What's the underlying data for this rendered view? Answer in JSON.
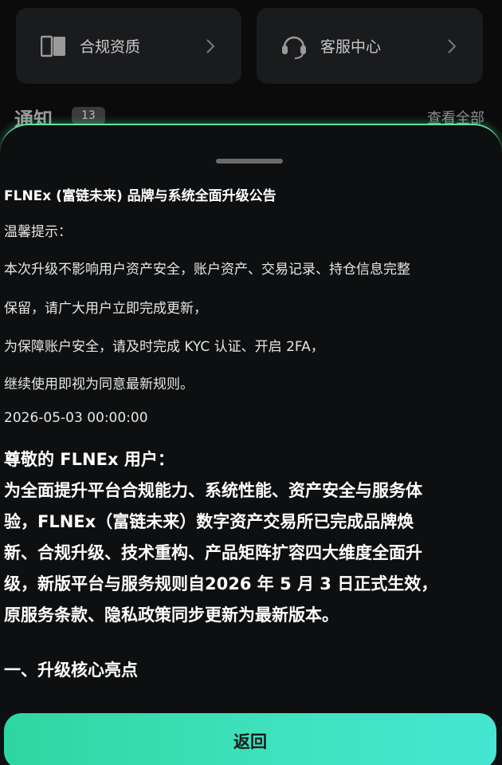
{
  "cards": {
    "compliance": {
      "label": "合规资质",
      "icon": "book-icon"
    },
    "service": {
      "label": "客服中心",
      "icon": "headset-icon"
    }
  },
  "notice": {
    "title": "通知",
    "count": "13",
    "view_all": "查看全部"
  },
  "announcement": {
    "title": "FLNEx (富链未来) 品牌与系统全面升级公告",
    "tip_header": "温馨提示：",
    "tip_lines": [
      "本次升级不影响用户资产安全，账户资产、交易记录、持仓信息完整",
      "保留，请广大用户立即完成更新，",
      "为保障账户安全，请及时完成 KYC 认证、开启 2FA，",
      "继续使用即视为同意最新规则。"
    ],
    "date": "2026-05-03 00:00:00",
    "greeting": "尊敬的 FLNEx 用户：",
    "body_lines": [
      "为全面提升平台合规能力、系统性能、资产安全与服务体",
      "验，FLNEx（富链未来）数字资产交易所已完成品牌焕",
      "新、合规升级、技术重构、产品矩阵扩容四大维度全面升",
      "级，新版平台与服务规则自2026 年 5 月 3 日正式生效，",
      "原服务条款、隐私政策同步更新为最新版本。"
    ],
    "section_heading": "一、升级核心亮点"
  },
  "back_button": {
    "label": "返回"
  },
  "colors": {
    "accent_start": "#2fd6a0",
    "accent_end": "#45e6d2",
    "glow": "#5fe3a1"
  }
}
